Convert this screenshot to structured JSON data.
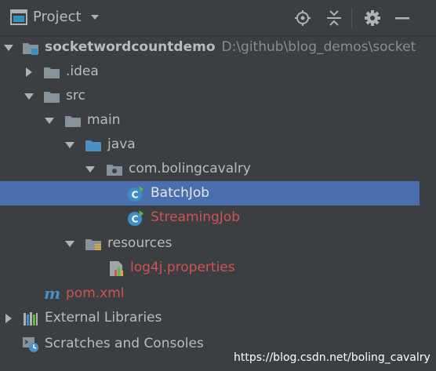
{
  "header": {
    "icon": "project-window-icon",
    "title": "Project",
    "buttons": [
      "locate-icon",
      "collapse-all-icon",
      "gear-icon",
      "hide-icon"
    ]
  },
  "tree": {
    "root": {
      "name": "socketwordcountdemo",
      "path": "D:\\github\\blog_demos\\socket"
    },
    "items": [
      {
        "name": ".idea"
      },
      {
        "name": "src"
      },
      {
        "name": "main"
      },
      {
        "name": "java"
      },
      {
        "name": "com.bolingcavalry"
      },
      {
        "name": "BatchJob"
      },
      {
        "name": "StreamingJob"
      },
      {
        "name": "resources"
      },
      {
        "name": "log4j.properties"
      },
      {
        "name": "pom.xml"
      },
      {
        "name": "External Libraries"
      },
      {
        "name": "Scratches and Consoles"
      }
    ]
  },
  "colors": {
    "background": "#3c3f41",
    "selection": "#4b6eaf",
    "modified_file": "#d25252",
    "folder": "#87939a",
    "source_folder": "#4a8fc7"
  },
  "watermark": "https://blog.csdn.net/boling_cavalry"
}
